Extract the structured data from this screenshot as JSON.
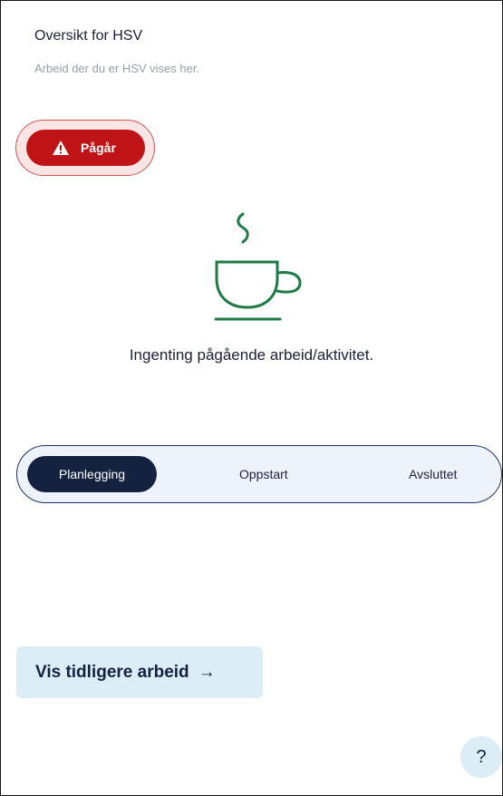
{
  "header": {
    "title": "Oversikt for HSV",
    "subtitle": "Arbeid der du er HSV vises her."
  },
  "status": {
    "label": "Pågår",
    "icon": "warning-triangle-icon",
    "color": "#bf1317"
  },
  "empty_state": {
    "icon": "coffee-cup-icon",
    "text": "Ingenting pågående arbeid/aktivitet.",
    "icon_color": "#1f7a45"
  },
  "phases": {
    "items": [
      "Planlegging",
      "Oppstart",
      "Avsluttet"
    ],
    "selected": "Planlegging"
  },
  "history_button": {
    "label": "Vis tidligere arbeid",
    "arrow": "→"
  },
  "help_button": {
    "label": "?"
  },
  "colors": {
    "navy": "#15223f",
    "light_blue": "#dcedf5",
    "red": "#bf1317"
  }
}
